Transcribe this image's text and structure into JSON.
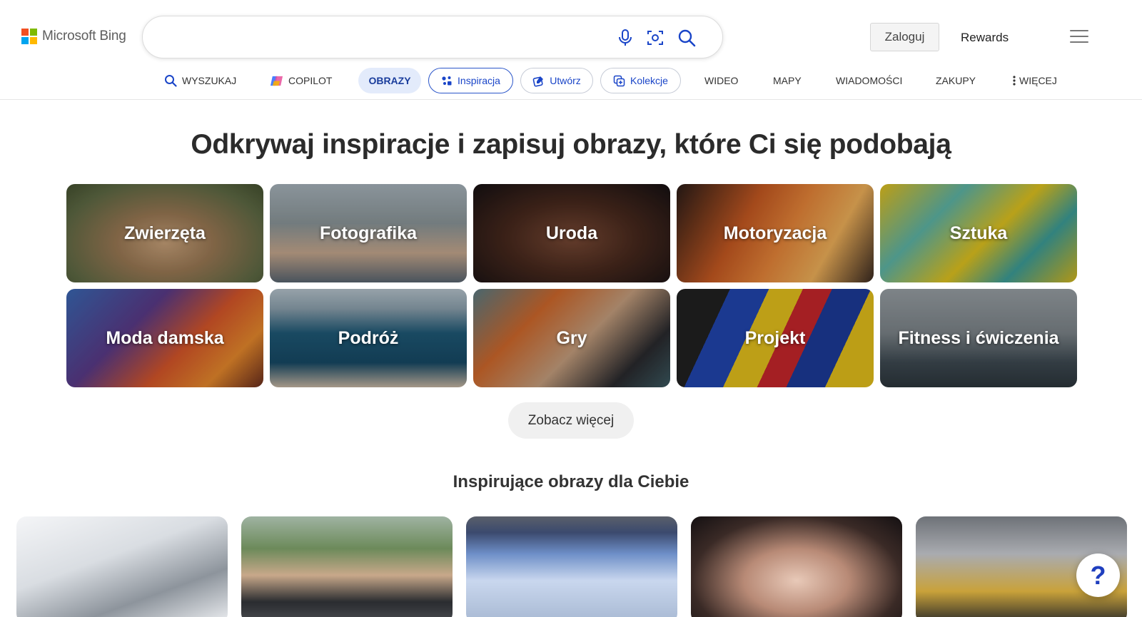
{
  "brand": {
    "logo_text": "Microsoft Bing"
  },
  "search": {
    "value": "",
    "placeholder": ""
  },
  "header": {
    "login_label": "Zaloguj",
    "rewards_label": "Rewards"
  },
  "nav": {
    "tabs": [
      {
        "label": "WYSZUKAJ",
        "icon": "search-icon"
      },
      {
        "label": "COPILOT",
        "icon": "copilot-icon"
      },
      {
        "label": "OBRAZY",
        "active": true
      },
      {
        "label": "Inspiracja",
        "icon": "inspiration-icon",
        "selected": true
      },
      {
        "label": "Utwórz",
        "icon": "create-icon"
      },
      {
        "label": "Kolekcje",
        "icon": "collections-icon"
      },
      {
        "label": "WIDEO"
      },
      {
        "label": "MAPY"
      },
      {
        "label": "WIADOMOŚCI"
      },
      {
        "label": "ZAKUPY"
      },
      {
        "label": "WIĘCEJ",
        "icon": "more-vertical-icon"
      }
    ]
  },
  "main": {
    "headline": "Odkrywaj inspiracje i zapisuj obrazy, które Ci się podobają",
    "categories": [
      {
        "label": "Zwierzęta"
      },
      {
        "label": "Fotografika"
      },
      {
        "label": "Uroda"
      },
      {
        "label": "Motoryzacja"
      },
      {
        "label": "Sztuka"
      },
      {
        "label": "Moda damska"
      },
      {
        "label": "Podróż"
      },
      {
        "label": "Gry"
      },
      {
        "label": "Projekt"
      },
      {
        "label": "Fitness i ćwiczenia"
      }
    ],
    "see_more_label": "Zobacz więcej",
    "subheadline": "Inspirujące obrazy dla Ciebie"
  },
  "help": {
    "label": "?"
  },
  "colors": {
    "accent": "#1a45c8",
    "active_tab_bg": "#e3ebfb",
    "ms_red": "#f25022",
    "ms_green": "#7fba00",
    "ms_blue": "#00a4ef",
    "ms_yellow": "#ffb900"
  }
}
